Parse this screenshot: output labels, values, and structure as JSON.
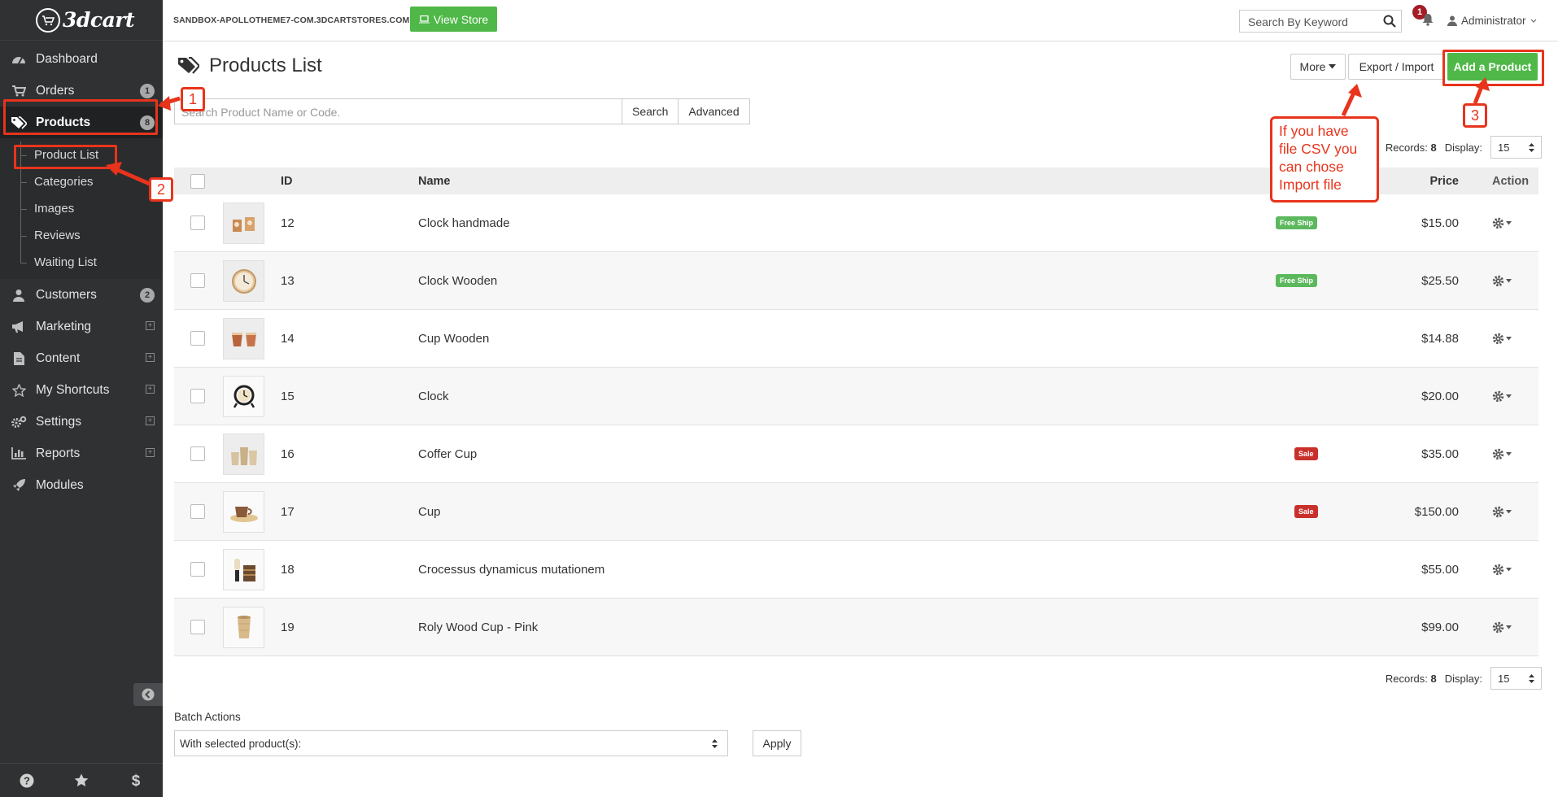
{
  "brand": {
    "logo_text": "3dcart"
  },
  "sidebar": {
    "items": [
      {
        "label": "Dashboard",
        "icon": "dashboard-icon"
      },
      {
        "label": "Orders",
        "icon": "cart-icon",
        "badge": "1"
      },
      {
        "label": "Products",
        "icon": "tags-icon",
        "badge": "8",
        "active": true
      },
      {
        "label": "Customers",
        "icon": "user-icon",
        "badge": "2"
      },
      {
        "label": "Marketing",
        "icon": "bullhorn-icon",
        "expandable": true
      },
      {
        "label": "Content",
        "icon": "file-icon",
        "expandable": true
      },
      {
        "label": "My Shortcuts",
        "icon": "star-icon",
        "expandable": true
      },
      {
        "label": "Settings",
        "icon": "gears-icon",
        "expandable": true
      },
      {
        "label": "Reports",
        "icon": "bar-chart-icon",
        "expandable": true
      },
      {
        "label": "Modules",
        "icon": "rocket-icon"
      }
    ],
    "subitems": [
      {
        "label": "Product List"
      },
      {
        "label": "Categories"
      },
      {
        "label": "Images"
      },
      {
        "label": "Reviews"
      },
      {
        "label": "Waiting List"
      }
    ]
  },
  "topbar": {
    "store_url": "SANDBOX-APOLLOTHEME7-COM.3DCARTSTORES.COM",
    "view_store": "View Store",
    "search_placeholder": "Search By Keyword",
    "notifications": "1",
    "user": "Administrator"
  },
  "page": {
    "title": "Products List",
    "more": "More",
    "export_import": "Export / Import",
    "add_product": "Add a Product",
    "search_placeholder": "Search Product Name or Code.",
    "search_btn": "Search",
    "advanced_btn": "Advanced",
    "records_label": "Records:",
    "records_count": "8",
    "display_label": "Display:",
    "display_value": "15"
  },
  "table": {
    "columns": [
      "ID",
      "Name",
      "Price",
      "Action"
    ],
    "rows": [
      {
        "id": "12",
        "name": "Clock handmade",
        "price": "$15.00",
        "tag": "Free Ship",
        "tag_type": "free"
      },
      {
        "id": "13",
        "name": "Clock Wooden",
        "price": "$25.50",
        "tag": "Free Ship",
        "tag_type": "free"
      },
      {
        "id": "14",
        "name": "Cup Wooden",
        "price": "$14.88",
        "tag": "",
        "tag_type": ""
      },
      {
        "id": "15",
        "name": "Clock",
        "price": "$20.00",
        "tag": "",
        "tag_type": ""
      },
      {
        "id": "16",
        "name": "Coffer Cup",
        "price": "$35.00",
        "tag": "Sale",
        "tag_type": "sale"
      },
      {
        "id": "17",
        "name": "Cup",
        "price": "$150.00",
        "tag": "Sale",
        "tag_type": "sale"
      },
      {
        "id": "18",
        "name": "Crocessus dynamicus mutationem",
        "price": "$55.00",
        "tag": "",
        "tag_type": ""
      },
      {
        "id": "19",
        "name": "Roly Wood Cup - Pink",
        "price": "$99.00",
        "tag": "",
        "tag_type": ""
      }
    ]
  },
  "batch": {
    "label": "Batch Actions",
    "select_value": "With selected product(s):",
    "apply": "Apply"
  },
  "annotations": {
    "step1": "1",
    "step2": "2",
    "step3": "3",
    "callout": "If you have file CSV you can chose Import file"
  },
  "colors": {
    "accent_green": "#4fb848",
    "annotation_red": "#e8341c",
    "sidebar_bg": "#2f3133"
  }
}
